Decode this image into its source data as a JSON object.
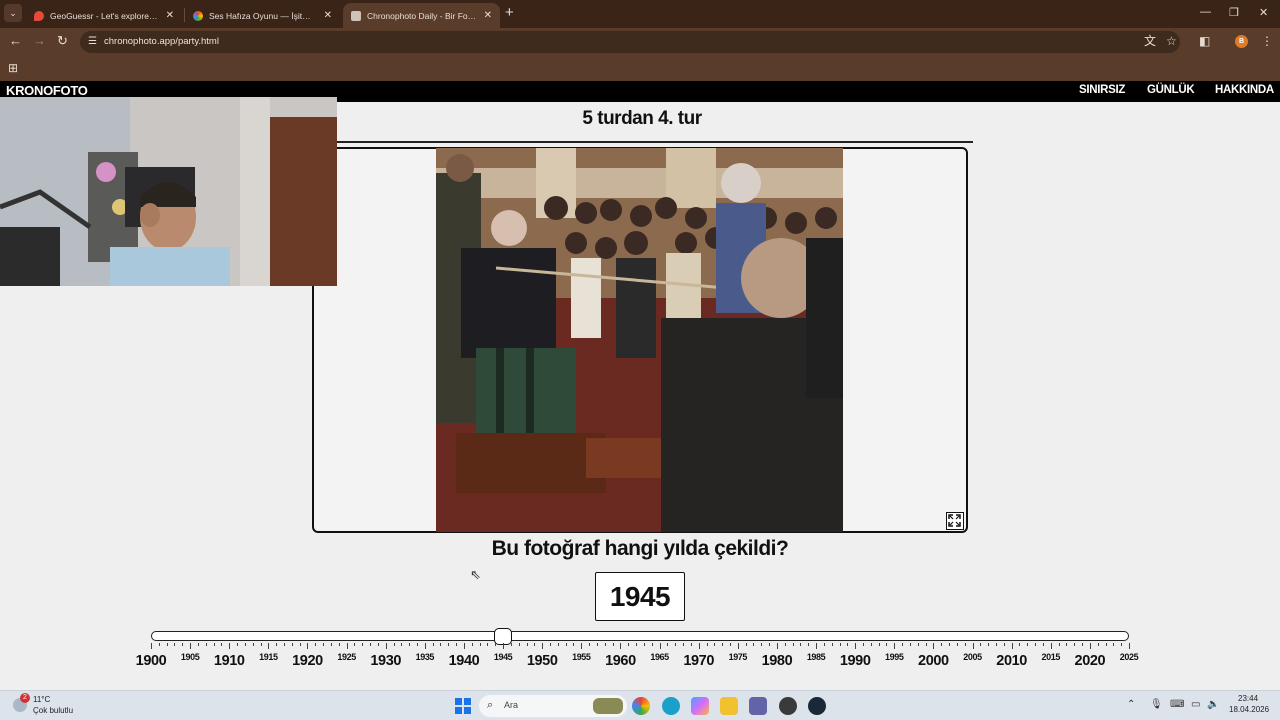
{
  "browser": {
    "tabs": [
      {
        "label": "GeoGuessr - Let's explore the w",
        "favicon": "map-pin-icon",
        "color": "#e64a3b"
      },
      {
        "label": "Ses Hafıza Oyunu — İşitme Yet",
        "favicon": "chrome-colorful-icon",
        "color": "#7b61ff"
      },
      {
        "label": "Chronophoto Daily - Bir Fotoğ",
        "favicon": "camera-icon",
        "color": "#cfc2b6"
      }
    ],
    "url": "chronophoto.app/party.html",
    "profile_initial": "B",
    "theme_color": "#5a3c2a"
  },
  "site": {
    "logo": "KRONOFOTO",
    "nav": [
      "SINIRSIZ",
      "GÜNLÜK",
      "HAKKINDA"
    ],
    "round_title": "5 turdan 4. tur",
    "question": "Bu fotoğraf hangi yılda çekildi?",
    "year_guess": "1945"
  },
  "slider": {
    "min": 1900,
    "max": 2025,
    "value": 1945,
    "major_labels": [
      "1900",
      "1910",
      "1920",
      "1930",
      "1940",
      "1950",
      "1960",
      "1970",
      "1980",
      "1990",
      "2000",
      "2010",
      "2020"
    ],
    "minor_labels": [
      "1905",
      "1915",
      "1925",
      "1935",
      "1945",
      "1955",
      "1965",
      "1975",
      "1985",
      "1995",
      "2005",
      "2015",
      "2025"
    ]
  },
  "taskbar": {
    "weather_temp": "11°C",
    "weather_desc": "Çok bulutlu",
    "weather_badge": "2",
    "search_placeholder": "Ara",
    "time": "23:44",
    "date": "18.04.2026"
  }
}
